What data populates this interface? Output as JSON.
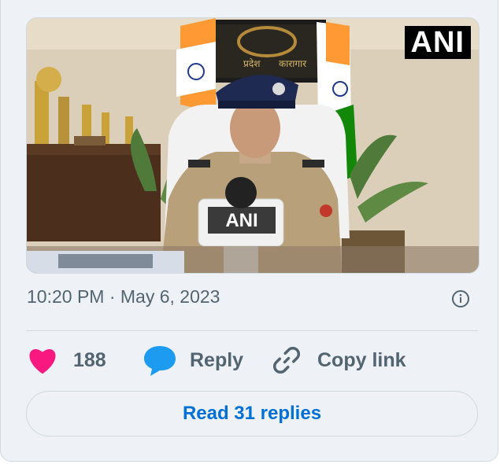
{
  "tweet": {
    "media": {
      "alt": "Police officer speaking to ANI microphone",
      "watermark": "ANI",
      "mic_label": "ANI",
      "sign_text_left": "प्रदेश",
      "sign_text_right": "कारागार"
    },
    "timestamp": "10:20 PM · May 6, 2023",
    "actions": {
      "like_count": "188",
      "reply_label": "Reply",
      "copy_label": "Copy link"
    },
    "read_replies_label": "Read 31 replies"
  },
  "colors": {
    "like": "#f91880",
    "reply": "#1d9bf0",
    "link_text": "#006fd6",
    "muted": "#536471"
  }
}
